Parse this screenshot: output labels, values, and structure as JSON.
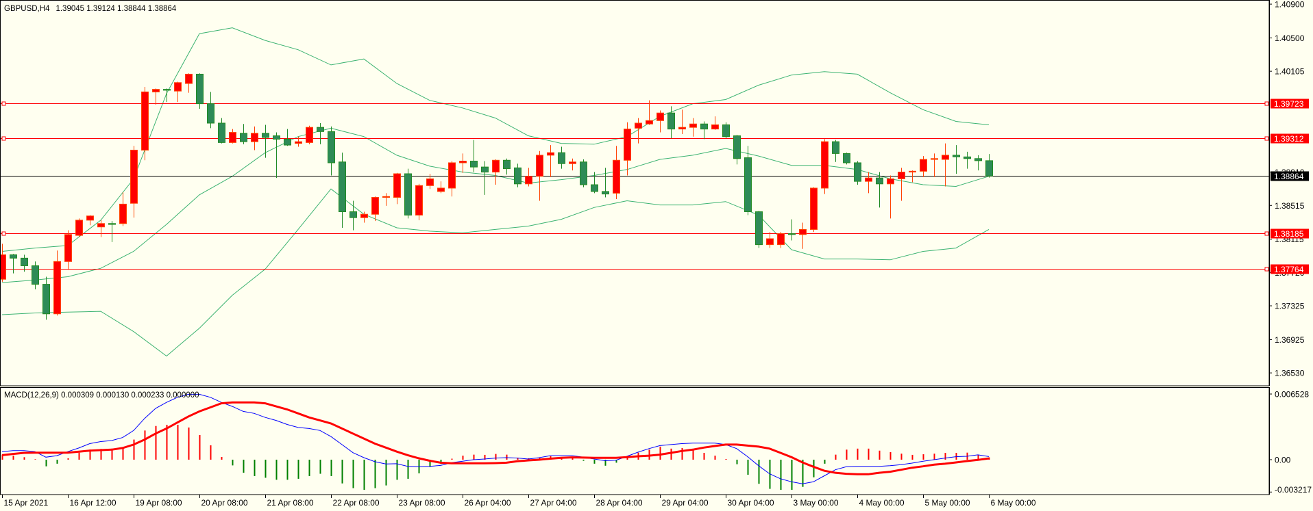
{
  "header": {
    "symbol_timeframe": "GBPUSD,H4",
    "ohlc_readout": "1.39045 1.39124 1.38844 1.38864"
  },
  "colors": {
    "background": "#FFFFF0",
    "bull_fill": "#FF0000",
    "bull_border": "#FF4500",
    "bear_fill": "#2E8B57",
    "bear_border": "#228B22",
    "bands": "#3CB371",
    "level_line": "#FF0000",
    "bid_line": "#000000",
    "macd_main": "#0000FF",
    "macd_signal": "#FF0000",
    "hist_up": "#FF0000",
    "hist_down": "#008000"
  },
  "chart_data": [
    {
      "type": "candlestick",
      "title": "GBPUSD,H4",
      "ylim": [
        1.36377,
        1.40941
      ],
      "y_ticks": [
        {
          "value": 1.409,
          "label": "1.40900"
        },
        {
          "value": 1.405,
          "label": "1.40500"
        },
        {
          "value": 1.40105,
          "label": "1.40105"
        },
        {
          "value": 1.3891,
          "label": "1.38910"
        },
        {
          "value": 1.38515,
          "label": "1.38515"
        },
        {
          "value": 1.38115,
          "label": "1.38115"
        },
        {
          "value": 1.3772,
          "label": "1.37720"
        },
        {
          "value": 1.37325,
          "label": "1.37325"
        },
        {
          "value": 1.36925,
          "label": "1.36925"
        },
        {
          "value": 1.3653,
          "label": "1.36530"
        }
      ],
      "horizontal_lines": [
        {
          "value": 1.39723,
          "label": "1.39723"
        },
        {
          "value": 1.39312,
          "label": "1.39312"
        },
        {
          "value": 1.38185,
          "label": "1.38185"
        },
        {
          "value": 1.37764,
          "label": "1.37764"
        }
      ],
      "bid_line": {
        "value": 1.38864,
        "label": "1.38864"
      },
      "x_labels": [
        {
          "index": 0,
          "label": "15 Apr 2021"
        },
        {
          "index": 6,
          "label": "16 Apr 12:00"
        },
        {
          "index": 12,
          "label": "19 Apr 08:00"
        },
        {
          "index": 18,
          "label": "20 Apr 08:00"
        },
        {
          "index": 24,
          "label": "21 Apr 08:00"
        },
        {
          "index": 30,
          "label": "22 Apr 08:00"
        },
        {
          "index": 36,
          "label": "23 Apr 08:00"
        },
        {
          "index": 42,
          "label": "26 Apr 04:00"
        },
        {
          "index": 48,
          "label": "27 Apr 04:00"
        },
        {
          "index": 54,
          "label": "28 Apr 04:00"
        },
        {
          "index": 60,
          "label": "29 Apr 04:00"
        },
        {
          "index": 66,
          "label": "30 Apr 04:00"
        },
        {
          "index": 72,
          "label": "3 May 00:00"
        },
        {
          "index": 78,
          "label": "4 May 00:00"
        },
        {
          "index": 84,
          "label": "5 May 00:00"
        },
        {
          "index": 90,
          "label": "6 May 00:00"
        }
      ],
      "ohlc": [
        [
          1.3764,
          1.3806,
          1.3761,
          1.3793
        ],
        [
          1.3793,
          1.3794,
          1.3771,
          1.3789
        ],
        [
          1.3789,
          1.3793,
          1.3773,
          1.378
        ],
        [
          1.378,
          1.3785,
          1.3752,
          1.3758
        ],
        [
          1.3758,
          1.3767,
          1.3716,
          1.3723
        ],
        [
          1.3723,
          1.3798,
          1.3721,
          1.3785
        ],
        [
          1.3785,
          1.3822,
          1.3775,
          1.3817
        ],
        [
          1.3816,
          1.3836,
          1.3814,
          1.3834
        ],
        [
          1.3834,
          1.384,
          1.3828,
          1.3839
        ],
        [
          1.3826,
          1.3834,
          1.3814,
          1.383
        ],
        [
          1.383,
          1.3833,
          1.3808,
          1.3829
        ],
        [
          1.383,
          1.3867,
          1.3827,
          1.3853
        ],
        [
          1.3854,
          1.3922,
          1.3837,
          1.3917
        ],
        [
          1.3917,
          1.3992,
          1.3905,
          1.3986
        ],
        [
          1.3986,
          1.399,
          1.3971,
          1.3989
        ],
        [
          1.3989,
          1.399,
          1.3974,
          1.3988
        ],
        [
          1.3987,
          1.3998,
          1.3974,
          1.3997
        ],
        [
          1.3996,
          1.4008,
          1.3985,
          1.4007
        ],
        [
          1.4007,
          1.4008,
          1.3966,
          1.3972
        ],
        [
          1.3972,
          1.3986,
          1.3943,
          1.3949
        ],
        [
          1.3949,
          1.3955,
          1.3925,
          1.3926
        ],
        [
          1.3926,
          1.3942,
          1.3925,
          1.3938
        ],
        [
          1.3937,
          1.3948,
          1.3924,
          1.3927
        ],
        [
          1.3927,
          1.3945,
          1.3917,
          1.3937
        ],
        [
          1.3937,
          1.3947,
          1.3908,
          1.3932
        ],
        [
          1.3934,
          1.3938,
          1.3884,
          1.393
        ],
        [
          1.393,
          1.3942,
          1.3922,
          1.3923
        ],
        [
          1.3925,
          1.3933,
          1.3921,
          1.3927
        ],
        [
          1.3926,
          1.3946,
          1.3924,
          1.3944
        ],
        [
          1.3944,
          1.3949,
          1.3924,
          1.3939
        ],
        [
          1.3939,
          1.3945,
          1.3887,
          1.3902
        ],
        [
          1.3903,
          1.3914,
          1.3825,
          1.3844
        ],
        [
          1.3844,
          1.3857,
          1.3822,
          1.3837
        ],
        [
          1.3837,
          1.3844,
          1.3831,
          1.3841
        ],
        [
          1.3841,
          1.3862,
          1.3833,
          1.3861
        ],
        [
          1.3861,
          1.3866,
          1.3851,
          1.3862
        ],
        [
          1.3861,
          1.389,
          1.3853,
          1.3889
        ],
        [
          1.3889,
          1.3895,
          1.3836,
          1.384
        ],
        [
          1.384,
          1.3877,
          1.3834,
          1.3875
        ],
        [
          1.3875,
          1.3889,
          1.3871,
          1.3883
        ],
        [
          1.3868,
          1.388,
          1.3866,
          1.3872
        ],
        [
          1.3872,
          1.3904,
          1.3862,
          1.3902
        ],
        [
          1.3902,
          1.3913,
          1.389,
          1.3904
        ],
        [
          1.3904,
          1.3929,
          1.3891,
          1.3897
        ],
        [
          1.3897,
          1.3904,
          1.3864,
          1.3891
        ],
        [
          1.3891,
          1.3906,
          1.3876,
          1.3905
        ],
        [
          1.3905,
          1.3907,
          1.3888,
          1.3895
        ],
        [
          1.3896,
          1.3901,
          1.3873,
          1.3877
        ],
        [
          1.3877,
          1.3896,
          1.3874,
          1.3886
        ],
        [
          1.3886,
          1.3916,
          1.3857,
          1.3911
        ],
        [
          1.3911,
          1.3923,
          1.3885,
          1.3914
        ],
        [
          1.3914,
          1.3921,
          1.3895,
          1.3901
        ],
        [
          1.3901,
          1.3907,
          1.3893,
          1.3903
        ],
        [
          1.3903,
          1.3906,
          1.3873,
          1.3876
        ],
        [
          1.3876,
          1.3891,
          1.3866,
          1.3868
        ],
        [
          1.3868,
          1.3896,
          1.3861,
          1.3865
        ],
        [
          1.3866,
          1.3922,
          1.3859,
          1.3905
        ],
        [
          1.3905,
          1.395,
          1.3887,
          1.3942
        ],
        [
          1.3943,
          1.3955,
          1.3925,
          1.3949
        ],
        [
          1.3948,
          1.3976,
          1.3947,
          1.3952
        ],
        [
          1.3952,
          1.3964,
          1.3938,
          1.3961
        ],
        [
          1.3961,
          1.3969,
          1.3931,
          1.3942
        ],
        [
          1.3942,
          1.3965,
          1.3936,
          1.3944
        ],
        [
          1.3944,
          1.3955,
          1.3933,
          1.3948
        ],
        [
          1.3948,
          1.3951,
          1.393,
          1.3942
        ],
        [
          1.3942,
          1.3957,
          1.3941,
          1.3947
        ],
        [
          1.3947,
          1.395,
          1.3931,
          1.3933
        ],
        [
          1.3934,
          1.3935,
          1.39,
          1.3907
        ],
        [
          1.3908,
          1.3922,
          1.384,
          1.3844
        ],
        [
          1.3844,
          1.3845,
          1.3801,
          1.3805
        ],
        [
          1.3805,
          1.382,
          1.3801,
          1.3812
        ],
        [
          1.3805,
          1.382,
          1.3801,
          1.3818
        ],
        [
          1.3818,
          1.3835,
          1.381,
          1.3817
        ],
        [
          1.3817,
          1.3831,
          1.38,
          1.3823
        ],
        [
          1.3823,
          1.3873,
          1.382,
          1.3872
        ],
        [
          1.3872,
          1.393,
          1.3865,
          1.3927
        ],
        [
          1.3927,
          1.3929,
          1.3903,
          1.3913
        ],
        [
          1.3913,
          1.3914,
          1.39,
          1.3902
        ],
        [
          1.3902,
          1.3904,
          1.3876,
          1.388
        ],
        [
          1.388,
          1.3891,
          1.3866,
          1.3884
        ],
        [
          1.3884,
          1.3891,
          1.3849,
          1.3877
        ],
        [
          1.3877,
          1.3887,
          1.3836,
          1.3883
        ],
        [
          1.3883,
          1.3896,
          1.3857,
          1.3891
        ],
        [
          1.3891,
          1.3893,
          1.3879,
          1.3892
        ],
        [
          1.3892,
          1.391,
          1.3885,
          1.3906
        ],
        [
          1.3906,
          1.3913,
          1.3885,
          1.3907
        ],
        [
          1.3906,
          1.3925,
          1.3874,
          1.3911
        ],
        [
          1.3911,
          1.3923,
          1.3889,
          1.3909
        ],
        [
          1.3909,
          1.3915,
          1.3895,
          1.3907
        ],
        [
          1.3907,
          1.3911,
          1.3893,
          1.39045
        ],
        [
          1.39045,
          1.39124,
          1.38844,
          1.38864
        ]
      ],
      "bollinger": {
        "sample_index": [
          0,
          3,
          6,
          9,
          12,
          15,
          18,
          21,
          24,
          27,
          30,
          33,
          36,
          39,
          42,
          45,
          48,
          51,
          54,
          57,
          60,
          63,
          66,
          69,
          72,
          75,
          78,
          81,
          84,
          87,
          90
        ],
        "upper": [
          1.3797,
          1.3801,
          1.3804,
          1.3834,
          1.3883,
          1.3984,
          1.4055,
          1.4062,
          1.4047,
          1.4036,
          1.4018,
          1.4025,
          1.3996,
          1.3976,
          1.3967,
          1.3955,
          1.3934,
          1.3925,
          1.3924,
          1.3933,
          1.3957,
          1.3972,
          1.3977,
          1.3994,
          1.4006,
          1.401,
          1.4007,
          1.3985,
          1.3965,
          1.3951,
          1.3947
        ],
        "middle": [
          1.376,
          1.3763,
          1.3767,
          1.3777,
          1.3797,
          1.3829,
          1.3864,
          1.3886,
          1.3914,
          1.3933,
          1.3943,
          1.3933,
          1.3911,
          1.3898,
          1.3891,
          1.3887,
          1.3878,
          1.3882,
          1.3887,
          1.3894,
          1.3906,
          1.3911,
          1.3919,
          1.391,
          1.3899,
          1.3899,
          1.3894,
          1.3883,
          1.3876,
          1.3874,
          1.3886
        ],
        "lower": [
          1.3722,
          1.3724,
          1.3725,
          1.3726,
          1.3702,
          1.3673,
          1.3706,
          1.3745,
          1.3776,
          1.3823,
          1.3871,
          1.3841,
          1.3825,
          1.3821,
          1.3819,
          1.3823,
          1.3827,
          1.3835,
          1.3849,
          1.3857,
          1.3852,
          1.3852,
          1.3856,
          1.384,
          1.3799,
          1.3788,
          1.3788,
          1.3787,
          1.3797,
          1.3801,
          1.3823
        ]
      }
    },
    {
      "type": "bar+line",
      "title": "MACD(12,26,9) 0.000309 0.000130 0.000233 0.000000",
      "ylim": [
        -0.00347,
        0.00714
      ],
      "y_ticks": [
        {
          "value": 0.006528,
          "label": "0.006528"
        },
        {
          "value": 0,
          "label": "0.00"
        },
        {
          "value": -0.003217,
          "label": "-0.003217"
        }
      ],
      "histogram": [
        0.0005,
        0.0004,
        0.00025,
        5e-05,
        -0.00066,
        -0.0004,
        0.00014,
        0.0007,
        0.001,
        0.00107,
        0.0011,
        0.0012,
        0.002,
        0.0029,
        0.00335,
        0.00347,
        0.00347,
        0.0032,
        0.00245,
        0.00143,
        0.00027,
        -0.00057,
        -0.0013,
        -0.00163,
        -0.0018,
        -0.002,
        -0.002,
        -0.0019,
        -0.00163,
        -0.0014,
        -0.00163,
        -0.00236,
        -0.00283,
        -0.003,
        -0.00283,
        -0.00256,
        -0.002,
        -0.0019,
        -0.00136,
        -0.00073,
        -0.00043,
        0.0001,
        0.0004,
        0.0005,
        0.00048,
        0.00057,
        0.0005,
        0.0002,
        0.00014,
        0.00018,
        0.00034,
        0.00025,
        0.00018,
        -0.00011,
        -0.0004,
        -0.0006,
        -0.0003,
        0.00023,
        0.0007,
        0.001,
        0.0013,
        0.0011,
        0.00116,
        0.00095,
        0.00068,
        0.0004,
        7e-05,
        -0.00045,
        -0.0015,
        -0.0024,
        -0.0029,
        -0.003,
        -0.003,
        -0.0027,
        -0.00175,
        -0.0004,
        0.0005,
        0.001,
        0.0011,
        0.0011,
        0.0009,
        0.00075,
        0.0006,
        0.00048,
        0.00054,
        0.0006,
        0.00068,
        0.00068,
        0.0007,
        0.0005,
        0.000233
      ],
      "main": [
        0.0008,
        0.0009,
        0.0009,
        0.0008,
        0.00025,
        0.0004,
        0.0008,
        0.00116,
        0.0016,
        0.0018,
        0.0019,
        0.0022,
        0.0029,
        0.0041,
        0.0051,
        0.0057,
        0.0062,
        0.0065,
        0.0065,
        0.0062,
        0.0057,
        0.0053,
        0.0048,
        0.0046,
        0.0042,
        0.0039,
        0.0035,
        0.0032,
        0.0031,
        0.0029,
        0.0023,
        0.0015,
        0.0007,
        0.0002,
        -0.0002,
        -0.00043,
        -0.0004,
        -0.00066,
        -0.0007,
        -0.00066,
        -0.00057,
        -0.0003,
        -0.00016,
        0,
        7e-05,
        0.00016,
        0.0002,
        0.00016,
        7e-05,
        0.0002,
        0.0004,
        0.0004,
        0.0004,
        0.00025,
        7e-05,
        -0.0001,
        -5e-05,
        0.00034,
        0.00075,
        0.0011,
        0.0014,
        0.0015,
        0.0016,
        0.00165,
        0.00165,
        0.00165,
        0.0015,
        0.0011,
        0.0003,
        -0.0006,
        -0.0014,
        -0.0019,
        -0.0022,
        -0.0024,
        -0.0022,
        -0.0016,
        -0.001,
        -0.0007,
        -0.00066,
        -0.00066,
        -0.00066,
        -0.0006,
        -0.0005,
        -0.00034,
        -0.00016,
        0,
        0.00016,
        0.0003,
        0.00034,
        0.00048,
        0.000309
      ],
      "signal": [
        0.00045,
        0.00057,
        0.00068,
        0.0007,
        0.0007,
        0.0007,
        0.0007,
        0.0008,
        0.0009,
        0.00095,
        0.001,
        0.00116,
        0.0015,
        0.002,
        0.0026,
        0.0031,
        0.0037,
        0.0043,
        0.0048,
        0.0052,
        0.0056,
        0.0057,
        0.0057,
        0.0057,
        0.0056,
        0.0053,
        0.005,
        0.0046,
        0.0042,
        0.0039,
        0.0036,
        0.0031,
        0.0026,
        0.0021,
        0.0016,
        0.0012,
        0.0008,
        0.00045,
        0.00014,
        -0.0001,
        -0.0003,
        -0.00036,
        -0.00036,
        -0.00036,
        -0.00036,
        -0.00034,
        -0.0003,
        -0.00016,
        -7e-05,
        0,
        0.0001,
        0.00018,
        0.00023,
        0.00021,
        0.00018,
        0.00018,
        0.00018,
        0.00025,
        0.00034,
        0.0004,
        0.0005,
        0.00068,
        0.00086,
        0.001,
        0.0012,
        0.00136,
        0.0015,
        0.0015,
        0.0014,
        0.0013,
        0.0011,
        0.00068,
        0.00025,
        -0.00027,
        -0.0007,
        -0.0011,
        -0.0013,
        -0.0014,
        -0.00145,
        -0.00145,
        -0.0013,
        -0.0012,
        -0.001,
        -0.0008,
        -0.00066,
        -0.0005,
        -0.0004,
        -0.00027,
        -0.00014,
        -2e-05,
        0.00013
      ]
    }
  ]
}
